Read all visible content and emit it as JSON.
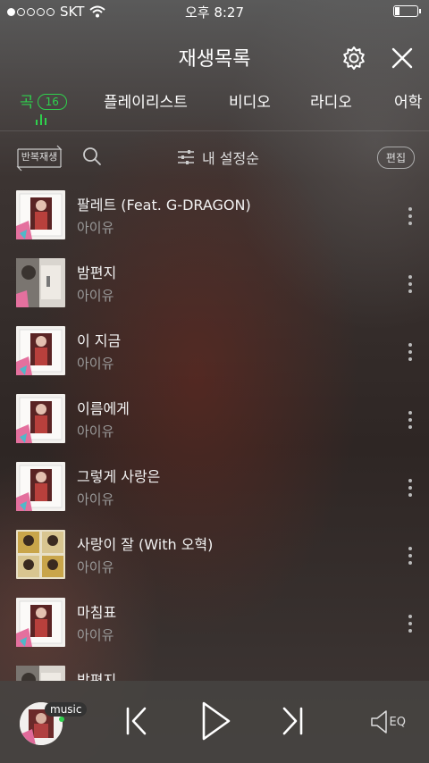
{
  "status_bar": {
    "carrier": "SKT",
    "time": "오후 8:27"
  },
  "header": {
    "title": "재생목록"
  },
  "tabs": [
    {
      "label": "곡",
      "badge": "16",
      "active": true
    },
    {
      "label": "플레이리스트"
    },
    {
      "label": "비디오"
    },
    {
      "label": "라디오"
    },
    {
      "label": "어학"
    }
  ],
  "toolbar": {
    "repeat_label": "반복재생",
    "sort_label": "내 설정순",
    "edit_label": "편집"
  },
  "songs": [
    {
      "title": "팔레트 (Feat. G-DRAGON)",
      "artist": "아이유",
      "art": "palette"
    },
    {
      "title": "밤편지",
      "artist": "아이유",
      "art": "night"
    },
    {
      "title": "이 지금",
      "artist": "아이유",
      "art": "palette"
    },
    {
      "title": "이름에게",
      "artist": "아이유",
      "art": "palette"
    },
    {
      "title": "그렇게 사랑은",
      "artist": "아이유",
      "art": "palette"
    },
    {
      "title": "사랑이 잘 (With 오혁)",
      "artist": "아이유",
      "art": "grid"
    },
    {
      "title": "마침표",
      "artist": "아이유",
      "art": "palette"
    },
    {
      "title": "밤편지",
      "artist": "",
      "art": "night"
    }
  ],
  "player": {
    "service_tag": "music"
  },
  "colors": {
    "accent": "#2fd04d"
  }
}
